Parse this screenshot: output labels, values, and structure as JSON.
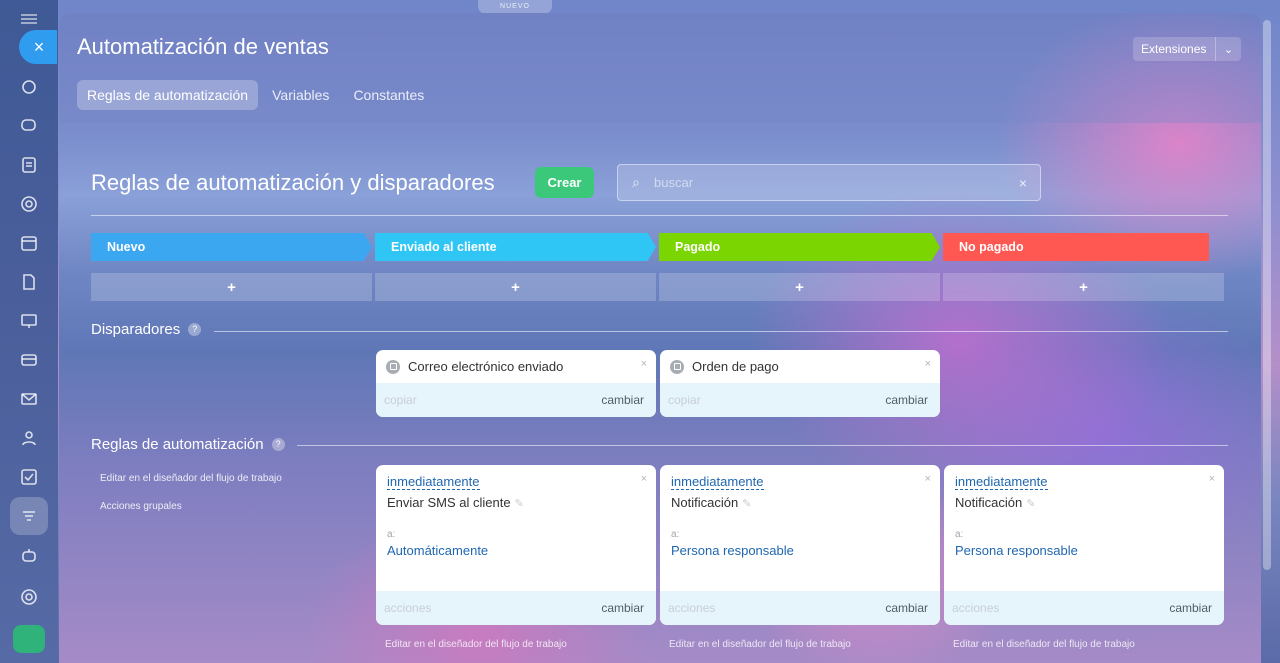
{
  "top_tab": "NUEVO",
  "header": {
    "title": "Automatización de ventas",
    "extensions_label": "Extensiones",
    "tabs": [
      {
        "label": "Reglas de automatización",
        "active": true
      },
      {
        "label": "Variables",
        "active": false
      },
      {
        "label": "Constantes",
        "active": false
      }
    ]
  },
  "main": {
    "heading": "Reglas de automatización y disparadores",
    "create_label": "Crear",
    "search_placeholder": "buscar"
  },
  "stages": [
    {
      "label": "Nuevo",
      "color": "#3ba7f0"
    },
    {
      "label": "Enviado al cliente",
      "color": "#2fc6f6"
    },
    {
      "label": "Pagado",
      "color": "#7bd500"
    },
    {
      "label": "No pagado",
      "color": "#ff5752"
    }
  ],
  "add_symbol": "+",
  "triggers_section": {
    "title": "Disparadores",
    "help": "?",
    "cards": [
      {
        "label": "Correo electrónico enviado",
        "copy": "copiar",
        "change": "cambiar"
      },
      {
        "label": "Orden de pago",
        "copy": "copiar",
        "change": "cambiar"
      }
    ]
  },
  "rules_section": {
    "title": "Reglas de automatización",
    "help": "?",
    "edit_designer": "Editar en el diseñador del flujo de trabajo",
    "group_actions": "Acciones grupales",
    "cards": [
      {
        "when": "inmediatamente",
        "name": "Enviar SMS al cliente",
        "to_label": "a:",
        "to": "Automáticamente",
        "actions": "acciones",
        "change": "cambiar",
        "footer_link": "Editar en el diseñador del flujo de trabajo"
      },
      {
        "when": "inmediatamente",
        "name": "Notificación",
        "to_label": "a:",
        "to": "Persona responsable",
        "actions": "acciones",
        "change": "cambiar",
        "footer_link": "Editar en el diseñador del flujo de trabajo"
      },
      {
        "when": "inmediatamente",
        "name": "Notificación",
        "to_label": "a:",
        "to": "Persona responsable",
        "actions": "acciones",
        "change": "cambiar",
        "footer_link": "Editar en el diseñador del flujo de trabajo"
      }
    ]
  },
  "icons": {
    "close": "×",
    "chevron": "⌄",
    "search": "⌕",
    "clear": "×",
    "card_close": "×",
    "pencil": "✎"
  }
}
